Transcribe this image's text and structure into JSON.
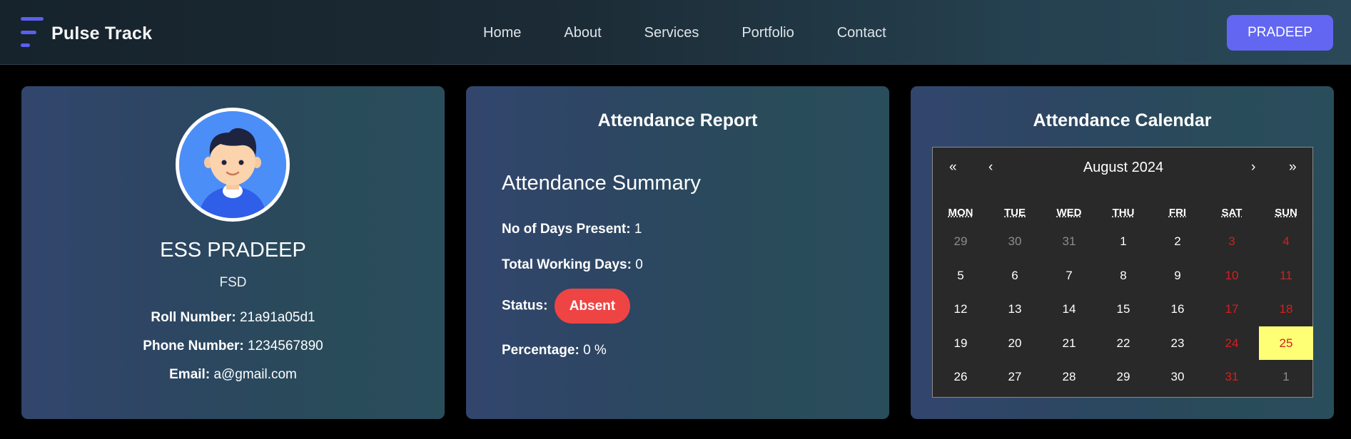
{
  "brand": {
    "name": "Pulse Track"
  },
  "nav": {
    "links": [
      "Home",
      "About",
      "Services",
      "Portfolio",
      "Contact"
    ],
    "user_button": "PRADEEP"
  },
  "profile": {
    "name": "ESS PRADEEP",
    "department": "FSD",
    "roll_label": "Roll Number:",
    "roll_value": "21a91a05d1",
    "phone_label": "Phone Number:",
    "phone_value": "1234567890",
    "email_label": "Email:",
    "email_value": "a@gmail.com"
  },
  "report": {
    "title": "Attendance Report",
    "summary_title": "Attendance Summary",
    "present_label": "No of Days Present:",
    "present_value": "1",
    "working_label": "Total Working Days:",
    "working_value": "0",
    "status_label": "Status:",
    "status_value": "Absent",
    "percentage_label": "Percentage:",
    "percentage_value": "0 %"
  },
  "calendar": {
    "title": "Attendance Calendar",
    "month": "August 2024",
    "nav": {
      "prev_year": "«",
      "prev_month": "‹",
      "next_month": "›",
      "next_year": "»"
    },
    "weekdays": [
      "MON",
      "TUE",
      "WED",
      "THU",
      "FRI",
      "SAT",
      "SUN"
    ],
    "weeks": [
      [
        "29",
        "30",
        "31",
        "1",
        "2",
        "3",
        "4"
      ],
      [
        "5",
        "6",
        "7",
        "8",
        "9",
        "10",
        "11"
      ],
      [
        "12",
        "13",
        "14",
        "15",
        "16",
        "17",
        "18"
      ],
      [
        "19",
        "20",
        "21",
        "22",
        "23",
        "24",
        "25"
      ],
      [
        "26",
        "27",
        "28",
        "29",
        "30",
        "31",
        "1"
      ]
    ],
    "outside_month": [
      [
        0,
        0
      ],
      [
        0,
        1
      ],
      [
        0,
        2
      ],
      [
        4,
        6
      ]
    ],
    "today": [
      3,
      6
    ],
    "colors": {
      "weekend": "#d32020",
      "today_bg": "#ffff76",
      "muted": "#8d8d8d"
    }
  },
  "colors": {
    "accent": "#6366f1",
    "absent": "#ef4444"
  }
}
